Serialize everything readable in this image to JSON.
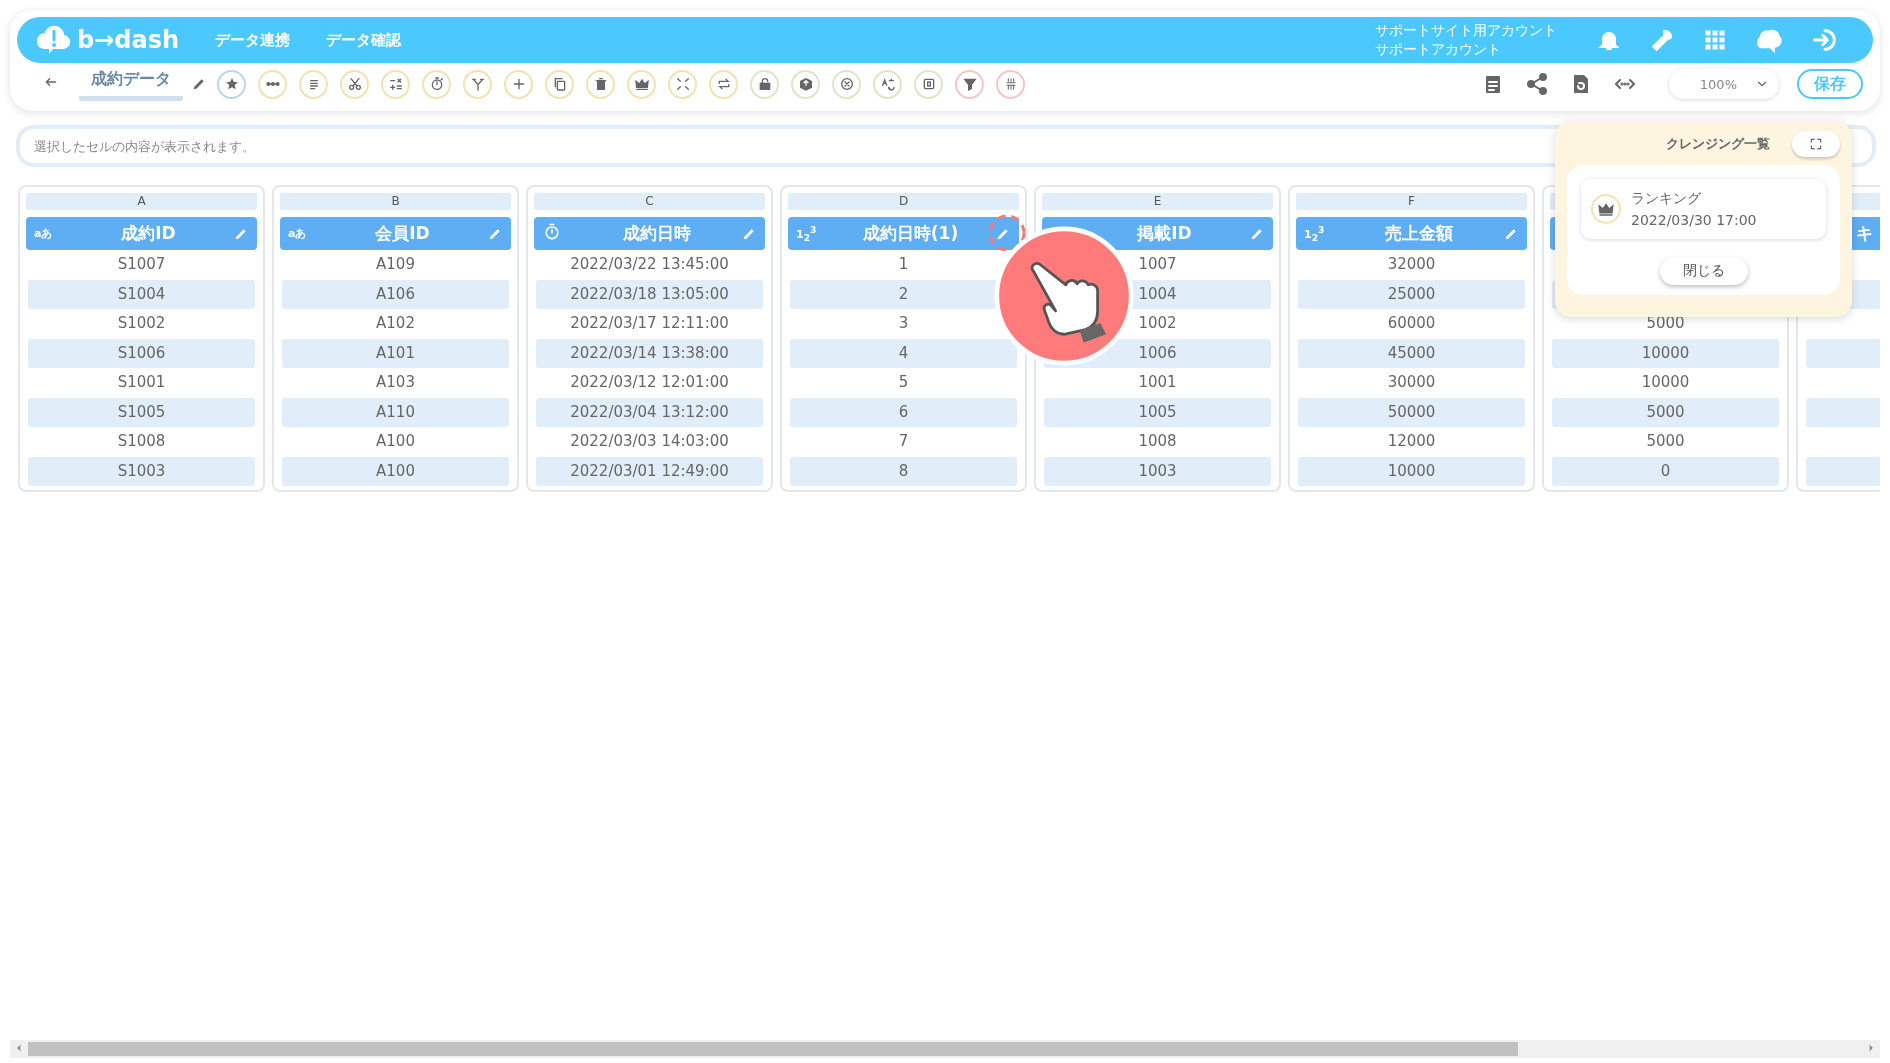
{
  "header": {
    "logo": "b→dash",
    "nav": [
      {
        "label": "データ連携"
      },
      {
        "label": "データ確認"
      }
    ],
    "account": [
      "サポートサイト用アカウント",
      "サポートアカウント"
    ]
  },
  "toolbar": {
    "title": "成約データ",
    "tools": [
      {
        "color": "#bcd6ee"
      },
      {
        "color": "#f6e1b0"
      },
      {
        "color": "#f6e1b0"
      },
      {
        "color": "#f6e1b0"
      },
      {
        "color": "#f6e1b0"
      },
      {
        "color": "#f6e1b0"
      },
      {
        "color": "#f6e1b0"
      },
      {
        "color": "#f6e1b0"
      },
      {
        "color": "#f6e1b0"
      },
      {
        "color": "#f6e1b0"
      },
      {
        "color": "#f6e1b0"
      },
      {
        "color": "#f6e1b0"
      },
      {
        "color": "#f6e1b0"
      },
      {
        "color": "#dfe6c8"
      },
      {
        "color": "#dfe6c8"
      },
      {
        "color": "#dfe6c8"
      },
      {
        "color": "#dfe6c8"
      },
      {
        "color": "#dfe6c8"
      },
      {
        "color": "#f7c6c6"
      },
      {
        "color": "#f7c6c6"
      }
    ],
    "zoom": "100%",
    "save": "保存"
  },
  "formula_bar": {
    "placeholder": "選択したセルの内容が表示されます。"
  },
  "columns": [
    {
      "letter": "A",
      "name": "成約ID",
      "kind": "text",
      "badge": "aあ",
      "cells": [
        "S1007",
        "S1004",
        "S1002",
        "S1006",
        "S1001",
        "S1005",
        "S1008",
        "S1003"
      ]
    },
    {
      "letter": "B",
      "name": "会員ID",
      "kind": "text",
      "badge": "aあ",
      "cells": [
        "A109",
        "A106",
        "A102",
        "A101",
        "A103",
        "A110",
        "A100",
        "A100"
      ]
    },
    {
      "letter": "C",
      "name": "成約日時",
      "kind": "datetime",
      "cells": [
        "2022/03/22 13:45:00",
        "2022/03/18 13:05:00",
        "2022/03/17 12:11:00",
        "2022/03/14 13:38:00",
        "2022/03/12 12:01:00",
        "2022/03/04 13:12:00",
        "2022/03/03 14:03:00",
        "2022/03/01 12:49:00"
      ]
    },
    {
      "letter": "D",
      "name": "成約日時(1)",
      "kind": "number",
      "badge": "1$_{2}$$^{3}$",
      "cells": [
        "1",
        "2",
        "3",
        "4",
        "5",
        "6",
        "7",
        "8"
      ]
    },
    {
      "letter": "E",
      "name": "掲載ID",
      "kind": "text",
      "cells": [
        "1007",
        "1004",
        "1002",
        "1006",
        "1001",
        "1005",
        "1008",
        "1003"
      ]
    },
    {
      "letter": "F",
      "name": "売上金額",
      "kind": "number",
      "badge": "1$_{2}$$^{3}$",
      "cells": [
        "32000",
        "25000",
        "60000",
        "45000",
        "30000",
        "50000",
        "12000",
        "10000"
      ]
    },
    {
      "kind": "number",
      "cells": [
        null,
        null,
        "5000",
        "10000",
        "10000",
        "5000",
        "5000",
        "0"
      ]
    },
    {
      "name": "キ",
      "kind": "text",
      "cut": true,
      "cells": [
        null,
        null,
        null,
        null,
        null,
        null,
        null,
        null
      ]
    }
  ],
  "cleansing_panel": {
    "title": "クレンジング一覧",
    "items": [
      {
        "name": "ランキング",
        "time": "2022/03/30 17:00"
      }
    ],
    "close": "閉じる"
  }
}
